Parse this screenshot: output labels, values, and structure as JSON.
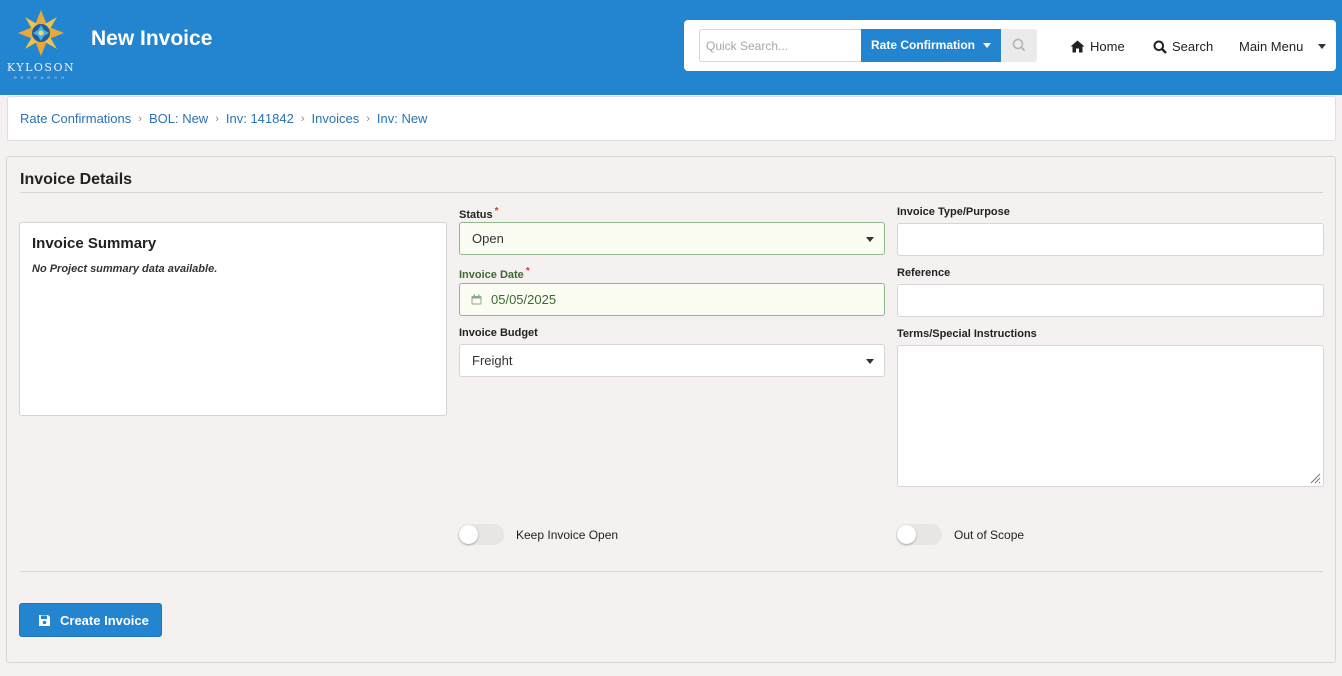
{
  "header": {
    "logo_text": "KYLOSON",
    "logo_subtext": "RESEARCH",
    "title": "New Invoice",
    "quick_search_placeholder": "Quick Search...",
    "search_type": "Rate Confirmation",
    "nav": {
      "home": "Home",
      "search": "Search",
      "main_menu": "Main Menu"
    }
  },
  "breadcrumb": [
    "Rate Confirmations",
    "BOL: New",
    "Inv: 141842",
    "Invoices",
    "Inv: New"
  ],
  "panel": {
    "title": "Invoice Details",
    "summary": {
      "title": "Invoice Summary",
      "empty_text": "No Project summary data available."
    },
    "fields": {
      "status": {
        "label": "Status",
        "value": "Open",
        "required_mark": "*"
      },
      "invoice_date": {
        "label": "Invoice Date",
        "value": "05/05/2025",
        "required_mark": "*"
      },
      "invoice_budget": {
        "label": "Invoice Budget",
        "value": "Freight"
      },
      "invoice_type": {
        "label": "Invoice Type/Purpose",
        "value": ""
      },
      "reference": {
        "label": "Reference",
        "value": ""
      },
      "terms": {
        "label": "Terms/Special Instructions",
        "value": ""
      }
    },
    "toggles": {
      "keep_open": {
        "label": "Keep Invoice Open"
      },
      "out_of_scope": {
        "label": "Out of Scope"
      }
    },
    "create_button": "Create Invoice"
  },
  "colors": {
    "header_blue": "#2384d0",
    "link_blue": "#2a72b5",
    "valid_green": "#3d6b2e",
    "required_red": "#d43b3b"
  }
}
